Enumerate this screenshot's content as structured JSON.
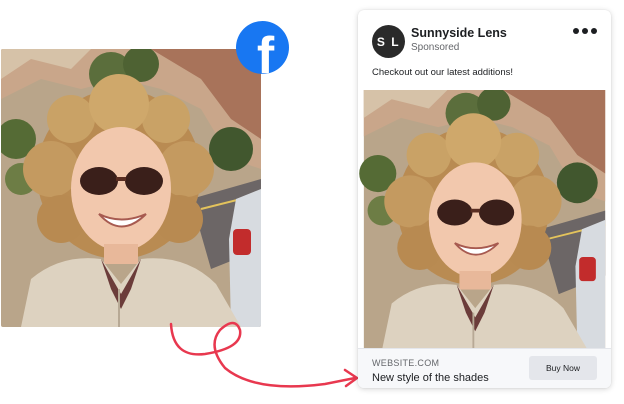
{
  "ad": {
    "avatar_initials": "S L",
    "page_name": "Sunnyside Lens",
    "sponsored_label": "Sponsored",
    "caption": "Checkout out our latest additions!",
    "site_url": "WEBSITE.COM",
    "headline": "New style of the shades",
    "cta_label": "Buy Now"
  },
  "badge": {
    "letter": "f",
    "color": "#1877f2"
  },
  "colors": {
    "arrow": "#e8384f"
  }
}
